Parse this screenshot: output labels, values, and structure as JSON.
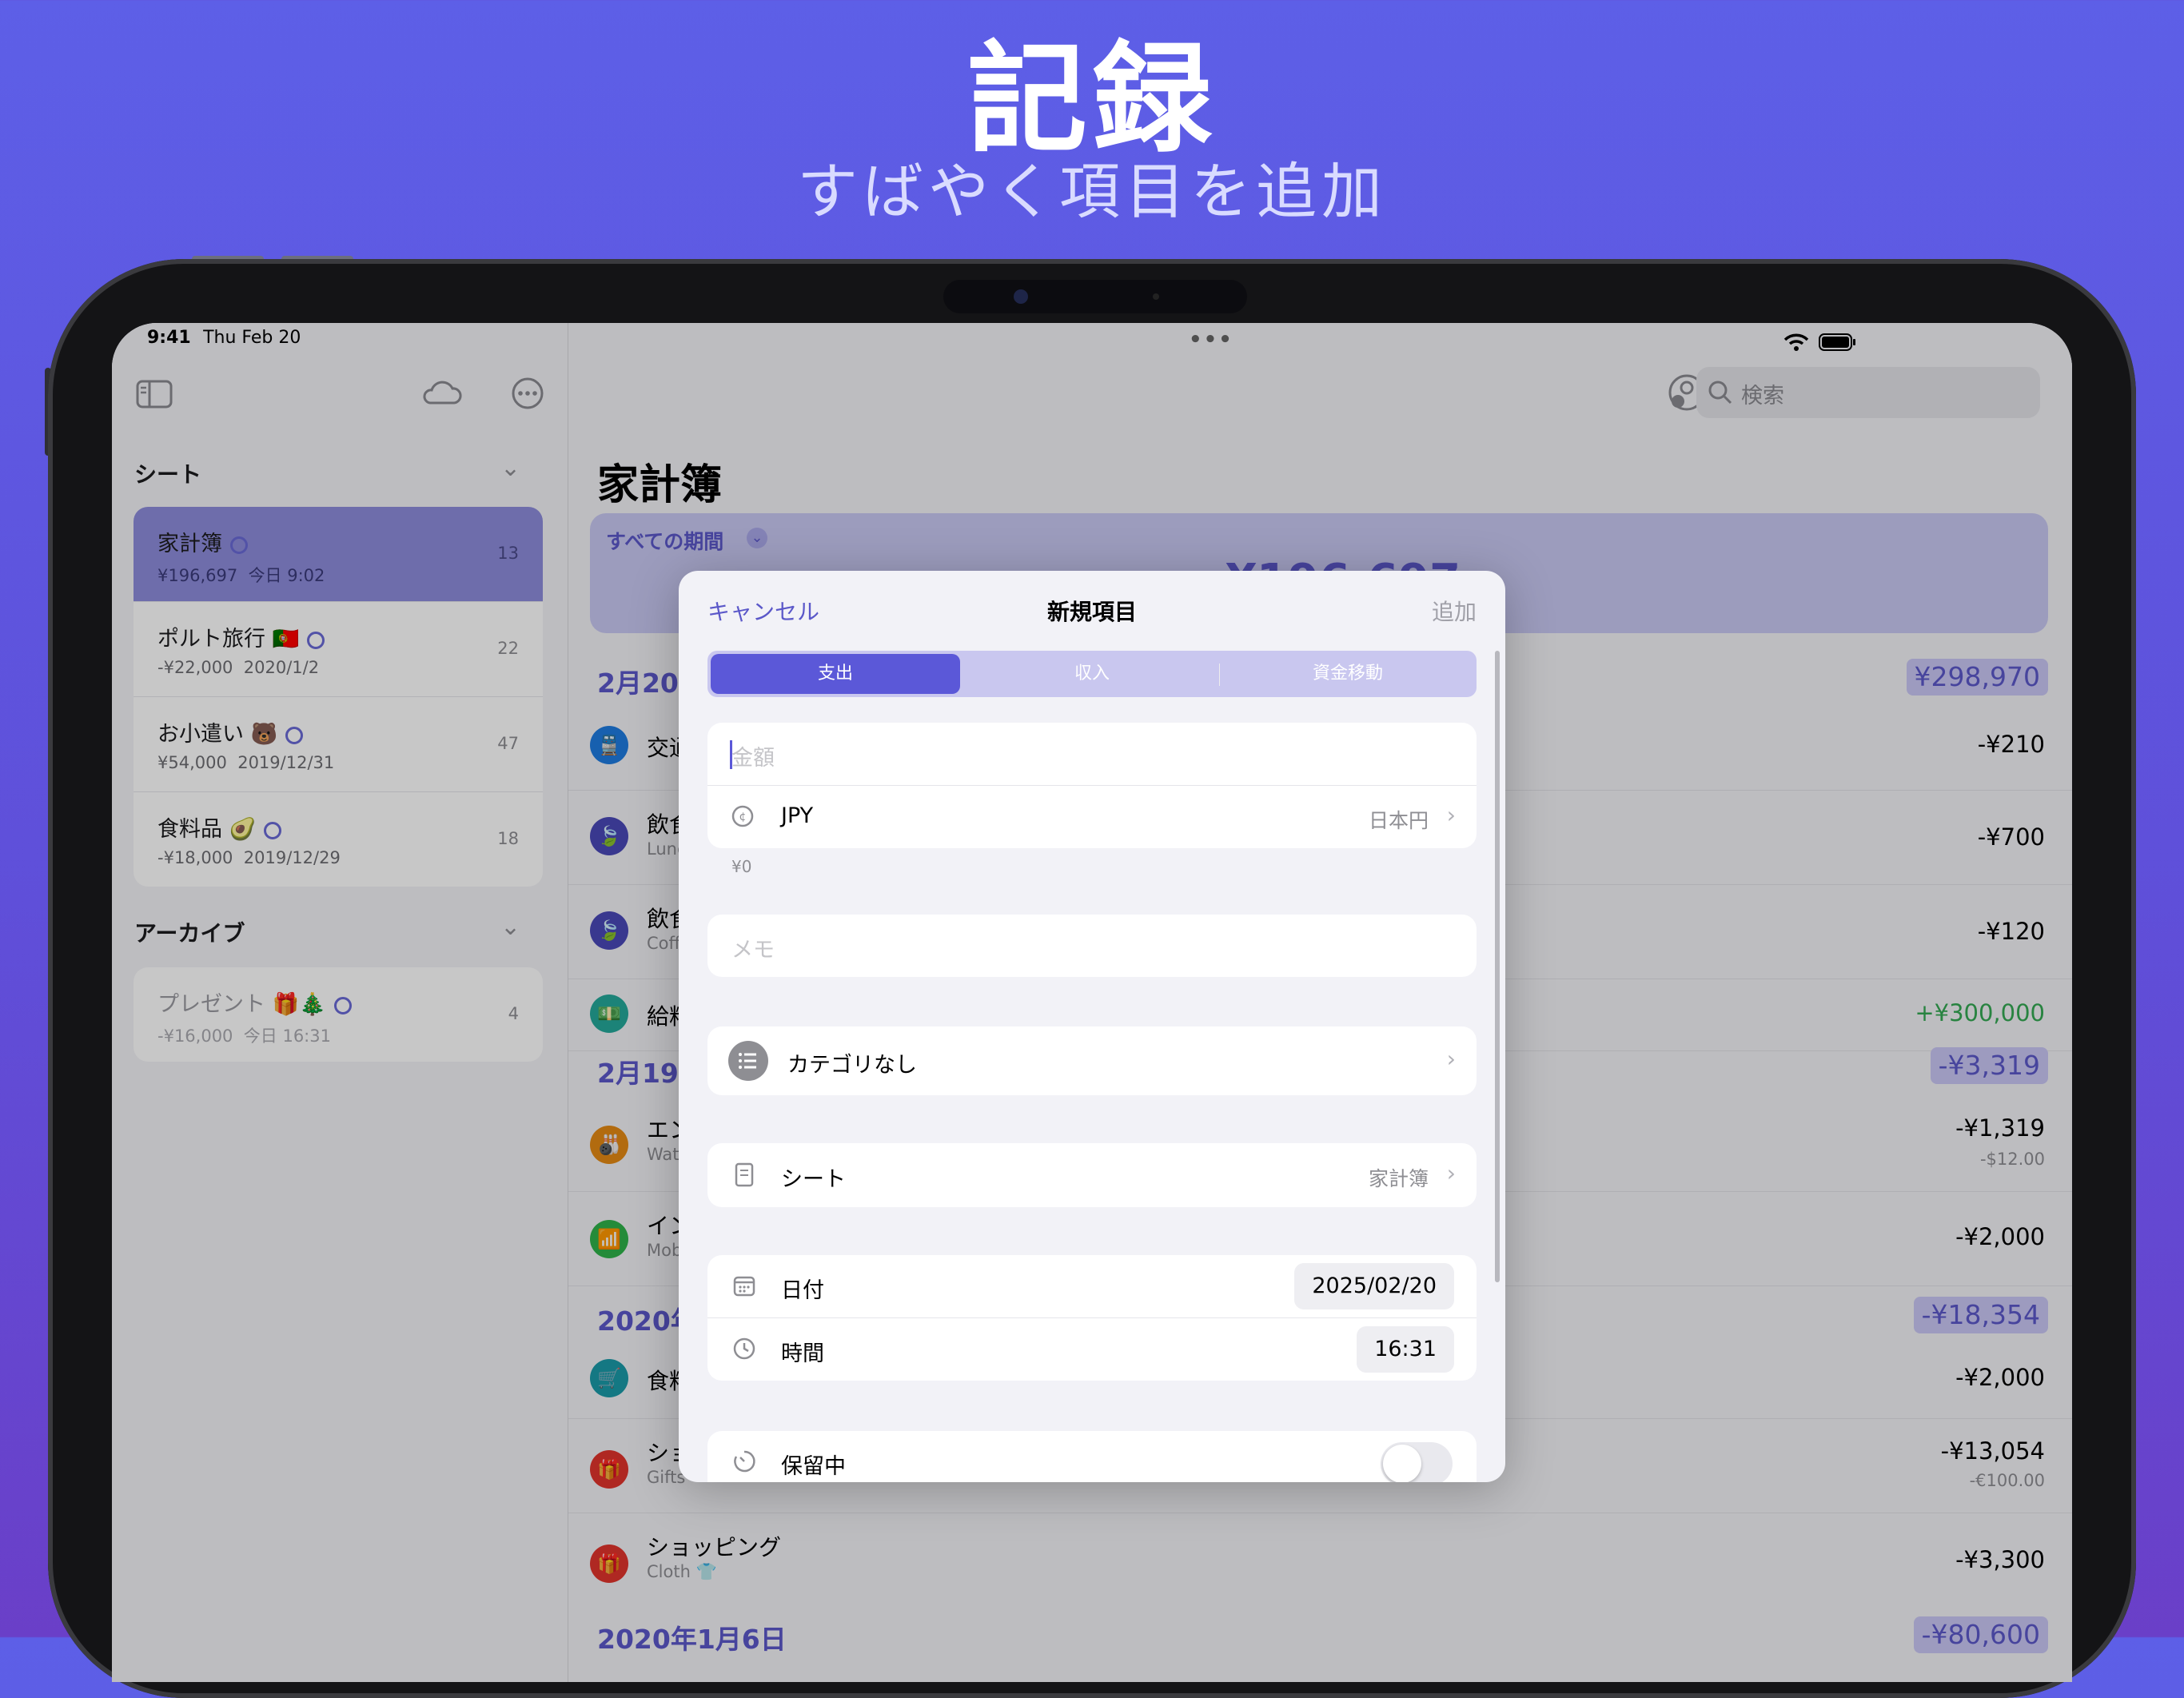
{
  "hero": {
    "title": "記録",
    "subtitle": "すばやく項目を追加"
  },
  "status": {
    "time": "9:41",
    "date": "Thu Feb 20",
    "dots": "•••"
  },
  "sidebar": {
    "sheets_title": "シート",
    "archive_title": "アーカイブ",
    "sheets": [
      {
        "name": "家計簿",
        "amount": "¥196,697",
        "date": "今日 9:02",
        "count": "13"
      },
      {
        "name": "ポルト旅行 🇵🇹",
        "amount": "-¥22,000",
        "date": "2020/1/2",
        "count": "22"
      },
      {
        "name": "お小遣い 🐻",
        "amount": "¥54,000",
        "date": "2019/12/31",
        "count": "47"
      },
      {
        "name": "食料品 🥑",
        "amount": "-¥18,000",
        "date": "2019/12/29",
        "count": "18"
      }
    ],
    "archive": [
      {
        "name": "プレゼント 🎁🎄",
        "amount": "-¥16,000",
        "date": "今日 16:31",
        "count": "4"
      }
    ]
  },
  "main": {
    "search_placeholder": "検索",
    "title": "家計簿",
    "period": "すべての期間",
    "period_total": "¥196,697",
    "days": [
      {
        "label": "2月20日",
        "total": "¥298,970"
      },
      {
        "label": "2月19日",
        "total": "-¥3,319"
      },
      {
        "label": "2020年",
        "total": "-¥18,354"
      },
      {
        "label": "2020年1月6日",
        "total": "-¥80,600"
      }
    ],
    "transactions": [
      {
        "name": "交通",
        "sub": "",
        "amount": "-¥210",
        "amount2": ""
      },
      {
        "name": "飲食",
        "sub": "Lunch",
        "amount": "-¥700",
        "amount2": ""
      },
      {
        "name": "飲食",
        "sub": "Coffee",
        "amount": "-¥120",
        "amount2": ""
      },
      {
        "name": "給料",
        "sub": "",
        "amount": "+¥300,000",
        "amount2": ""
      },
      {
        "name": "エン",
        "sub": "Wat",
        "amount": "-¥1,319",
        "amount2": "-$12.00"
      },
      {
        "name": "イン",
        "sub": "Mob",
        "amount": "-¥2,000",
        "amount2": ""
      },
      {
        "name": "食料",
        "sub": "",
        "amount": "-¥2,000",
        "amount2": ""
      },
      {
        "name": "ショ",
        "sub": "Gifts",
        "amount": "-¥13,054",
        "amount2": "-€100.00"
      },
      {
        "name": "ショッピング",
        "sub": "Cloth 👕",
        "amount": "-¥3,300",
        "amount2": ""
      }
    ]
  },
  "modal": {
    "cancel": "キャンセル",
    "title": "新規項目",
    "add": "追加",
    "segments": [
      "支出",
      "収入",
      "資金移動"
    ],
    "amount_placeholder": "金額",
    "currency_code": "JPY",
    "currency_name": "日本円",
    "converted": "¥0",
    "memo_placeholder": "メモ",
    "category": "カテゴリなし",
    "sheet_label": "シート",
    "sheet_value": "家計簿",
    "date_label": "日付",
    "date_value": "2025/02/20",
    "time_label": "時間",
    "time_value": "16:31",
    "pending_label": "保留中"
  },
  "colors": {
    "accent": "#5b58d8",
    "positive": "#34c759",
    "background_top": "#5d5fe7",
    "background_bottom": "#6a3fc8"
  }
}
